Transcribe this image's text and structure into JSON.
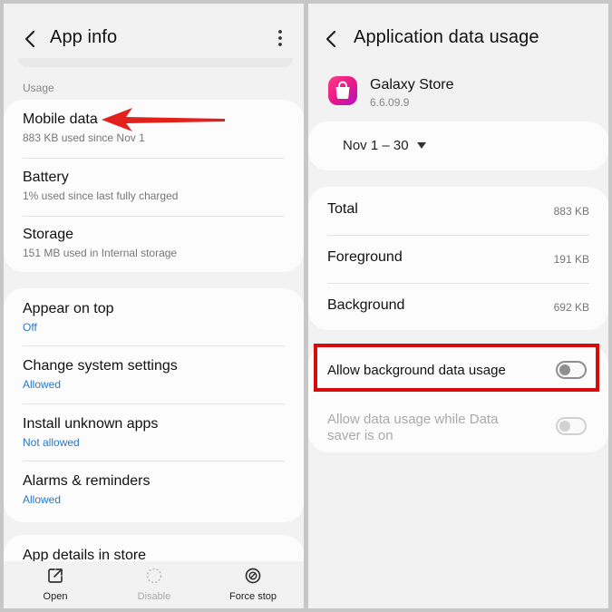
{
  "left": {
    "title": "App info",
    "section_usage": "Usage",
    "usage_items": [
      {
        "title": "Mobile data",
        "sub": "883 KB used since Nov 1"
      },
      {
        "title": "Battery",
        "sub": "1% used since last fully charged"
      },
      {
        "title": "Storage",
        "sub": "151 MB used in Internal storage"
      }
    ],
    "permission_items": [
      {
        "title": "Appear on top",
        "sub": "Off"
      },
      {
        "title": "Change system settings",
        "sub": "Allowed"
      },
      {
        "title": "Install unknown apps",
        "sub": "Not allowed"
      },
      {
        "title": "Alarms & reminders",
        "sub": "Allowed"
      }
    ],
    "store_item": "App details in store",
    "bottom_bar": {
      "open": "Open",
      "disable": "Disable",
      "force_stop": "Force stop"
    }
  },
  "right": {
    "title": "Application data usage",
    "app_name": "Galaxy Store",
    "app_version": "6.6.09.9",
    "period": "Nov 1 – 30",
    "usage_rows": [
      {
        "label": "Total",
        "value": "883 KB"
      },
      {
        "label": "Foreground",
        "value": "191 KB"
      },
      {
        "label": "Background",
        "value": "692 KB"
      }
    ],
    "allow_background": {
      "label": "Allow background data usage",
      "enabled": false
    },
    "allow_data_saver": {
      "label_line1": "Allow data usage while Data",
      "label_line2": "saver is on",
      "enabled": false
    }
  },
  "colors": {
    "accent_blue": "#2b78c2",
    "highlight_red": "#d60b0b",
    "app_icon_pink": "#e8168a"
  },
  "icons": [
    "back-arrow-icon",
    "more-vert-icon",
    "open-external-icon",
    "disable-icon",
    "force-stop-icon",
    "shopping-bag-icon",
    "dropdown-caret-icon",
    "red-pointer-arrow"
  ]
}
